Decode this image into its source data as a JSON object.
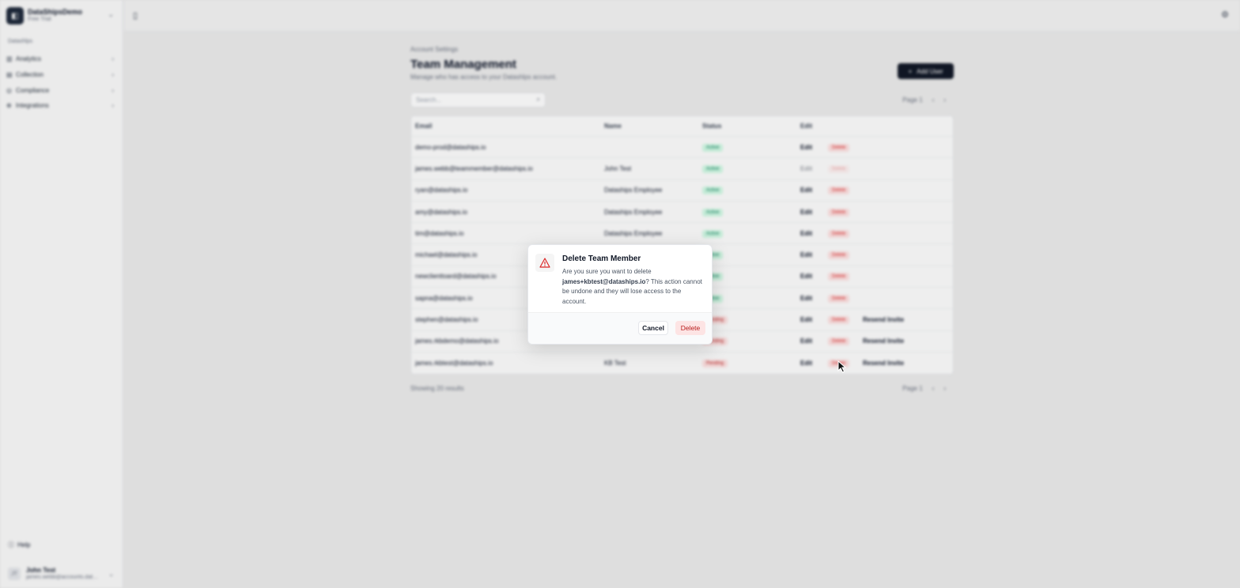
{
  "sidebar": {
    "workspace_name": "DataShipsDemo",
    "workspace_plan": "Free Trial",
    "section_label": "Datashlps",
    "items": [
      {
        "label": "Analytics"
      },
      {
        "label": "Collection"
      },
      {
        "label": "Compliance"
      },
      {
        "label": "Integrations"
      }
    ],
    "help_label": "Help",
    "user_name": "John Test",
    "user_email": "james.webb@accounts.datashlps.io"
  },
  "main": {
    "breadcrumb": "Account Settings",
    "title": "Team Management",
    "subtitle": "Manage who has access to your Datashlps account.",
    "add_user_label": "Add User",
    "search_placeholder": "Search...",
    "page_label": "Page 1",
    "showing_text": "Showing 20 results",
    "columns": {
      "email": "Email",
      "name": "Name",
      "status": "Status",
      "edit": "Edit"
    },
    "edit_label": "Edit",
    "delete_label": "Delete",
    "resend_label": "Resend Invite",
    "rows": [
      {
        "email": "demo-prod@dataships.io",
        "name": "",
        "status": "Active"
      },
      {
        "email": "james.webb@teammember@dataships.io",
        "name": "John Test",
        "status": "Active"
      },
      {
        "email": "ryan@dataships.io",
        "name": "Dataships Employee",
        "status": "Active"
      },
      {
        "email": "amy@dataships.io",
        "name": "Dataships Employee",
        "status": "Active"
      },
      {
        "email": "tim@dataships.io",
        "name": "Dataships Employee",
        "status": "Active"
      },
      {
        "email": "michael@dataships.io",
        "name": "",
        "status": "Active"
      },
      {
        "email": "newclienttoard@dataships.io",
        "name": "",
        "status": "Active"
      },
      {
        "email": "sapna@dataships.io",
        "name": "",
        "status": "Active"
      },
      {
        "email": "stephen@dataships.io",
        "name": "",
        "status": "Pending"
      },
      {
        "email": "james.rkbdemo@dataships.io",
        "name": "",
        "status": "Pending"
      },
      {
        "email": "james.rkbtest@dataships.io",
        "name": "KB Test",
        "status": "Pending"
      }
    ]
  },
  "modal": {
    "title": "Delete Team Member",
    "body_prefix": "Are you sure you want to delete",
    "email": "james+kbtest@dataships.io",
    "body_suffix": "? This action cannot be undone and they will lose access to the account.",
    "cancel_label": "Cancel",
    "delete_label": "Delete"
  },
  "colors": {
    "brand_dark": "#111827",
    "danger": "#dc2626",
    "success": "#047857"
  }
}
